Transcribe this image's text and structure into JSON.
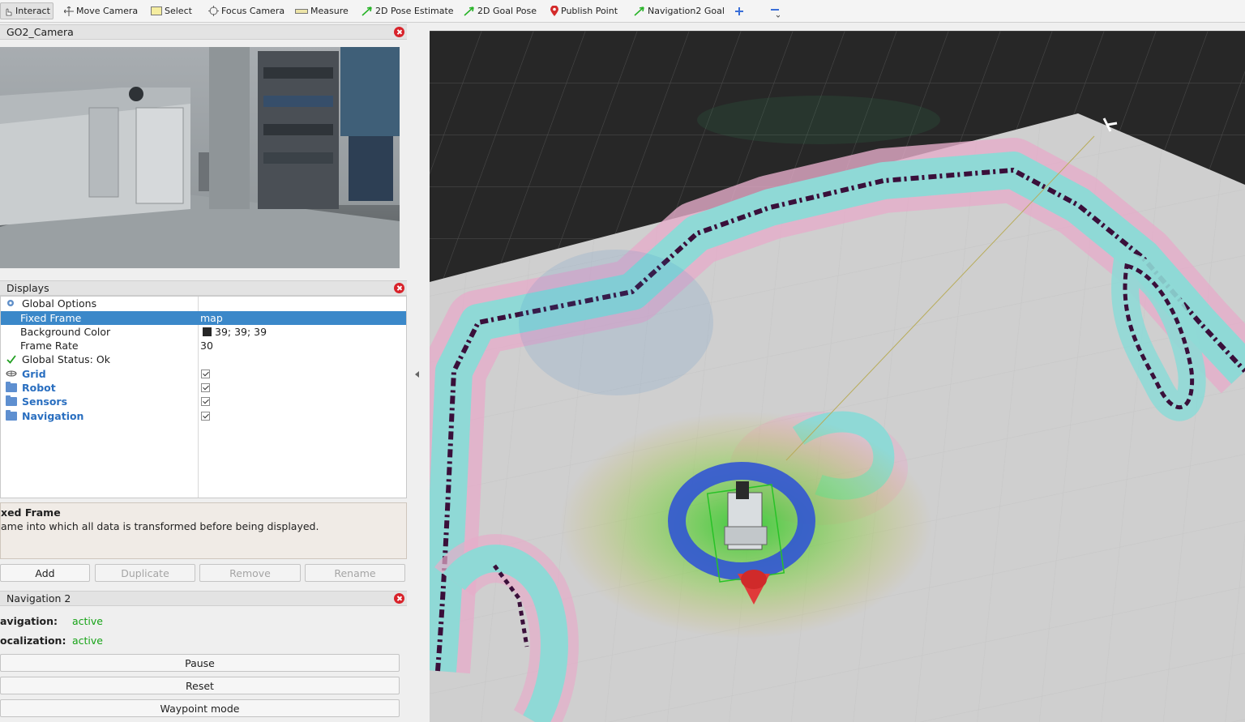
{
  "toolbar": {
    "interact": "Interact",
    "move_camera": "Move Camera",
    "select": "Select",
    "focus_camera": "Focus Camera",
    "measure": "Measure",
    "pose_estimate": "2D Pose Estimate",
    "goal_pose": "2D Goal Pose",
    "publish_point": "Publish Point",
    "nav2_goal": "Navigation2 Goal"
  },
  "camera_panel": {
    "title": "GO2_Camera"
  },
  "displays_panel": {
    "title": "Displays",
    "global_options": "Global Options",
    "fixed_frame_label": "Fixed Frame",
    "fixed_frame_value": "map",
    "bg_color_label": "Background Color",
    "bg_color_value": "39; 39; 39",
    "frame_rate_label": "Frame Rate",
    "frame_rate_value": "30",
    "global_status": "Global Status: Ok",
    "items": [
      "Grid",
      "Robot",
      "Sensors",
      "Navigation"
    ]
  },
  "help": {
    "title": "xed Frame",
    "text": "ame into which all data is transformed before being displayed."
  },
  "buttons": {
    "add": "Add",
    "duplicate": "Duplicate",
    "remove": "Remove",
    "rename": "Rename"
  },
  "nav_panel": {
    "title": "Navigation 2",
    "navigation_label": "avigation:",
    "navigation_value": "active",
    "localization_label": "ocalization:",
    "localization_value": "active",
    "pause": "Pause",
    "reset": "Reset",
    "waypoint": "Waypoint mode"
  },
  "colors": {
    "background_swatch": "#272727",
    "active_status": "#17a317",
    "selection": "#3b88c9",
    "inflation_cyan": "#8fd6d4",
    "inflation_pink": "#e2a9c8",
    "obstacle": "#3a0f3a",
    "footprint_ring": "#2b4fd8"
  }
}
